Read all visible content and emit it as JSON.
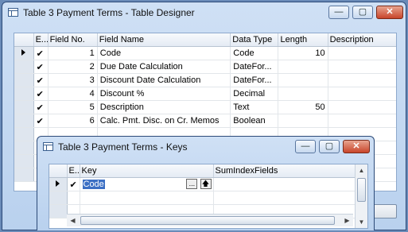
{
  "designer": {
    "title": "Table 3 Payment Terms - Table Designer",
    "columns": [
      "E...",
      "Field No.",
      "Field Name",
      "Data Type",
      "Length",
      "Description"
    ],
    "rows": [
      {
        "enabled": "✔",
        "no": "1",
        "name": "Code",
        "type": "Code",
        "length": "10",
        "desc": ""
      },
      {
        "enabled": "✔",
        "no": "2",
        "name": "Due Date Calculation",
        "type": "DateFor...",
        "length": "",
        "desc": ""
      },
      {
        "enabled": "✔",
        "no": "3",
        "name": "Discount Date Calculation",
        "type": "DateFor...",
        "length": "",
        "desc": ""
      },
      {
        "enabled": "✔",
        "no": "4",
        "name": "Discount %",
        "type": "Decimal",
        "length": "",
        "desc": ""
      },
      {
        "enabled": "✔",
        "no": "5",
        "name": "Description",
        "type": "Text",
        "length": "50",
        "desc": ""
      },
      {
        "enabled": "✔",
        "no": "6",
        "name": "Calc. Pmt. Disc. on Cr. Memos",
        "type": "Boolean",
        "length": "",
        "desc": ""
      }
    ]
  },
  "keys": {
    "title": "Table 3 Payment Terms - Keys",
    "columns": [
      "E...",
      "Key",
      "SumIndexFields"
    ],
    "rows": [
      {
        "enabled": "✔",
        "key": "Code",
        "sumindex": ""
      }
    ],
    "lookup_button": "...",
    "up_button": "🡅"
  },
  "window_controls": {
    "minimize": "—",
    "maximize": "▢",
    "close": "✕"
  }
}
